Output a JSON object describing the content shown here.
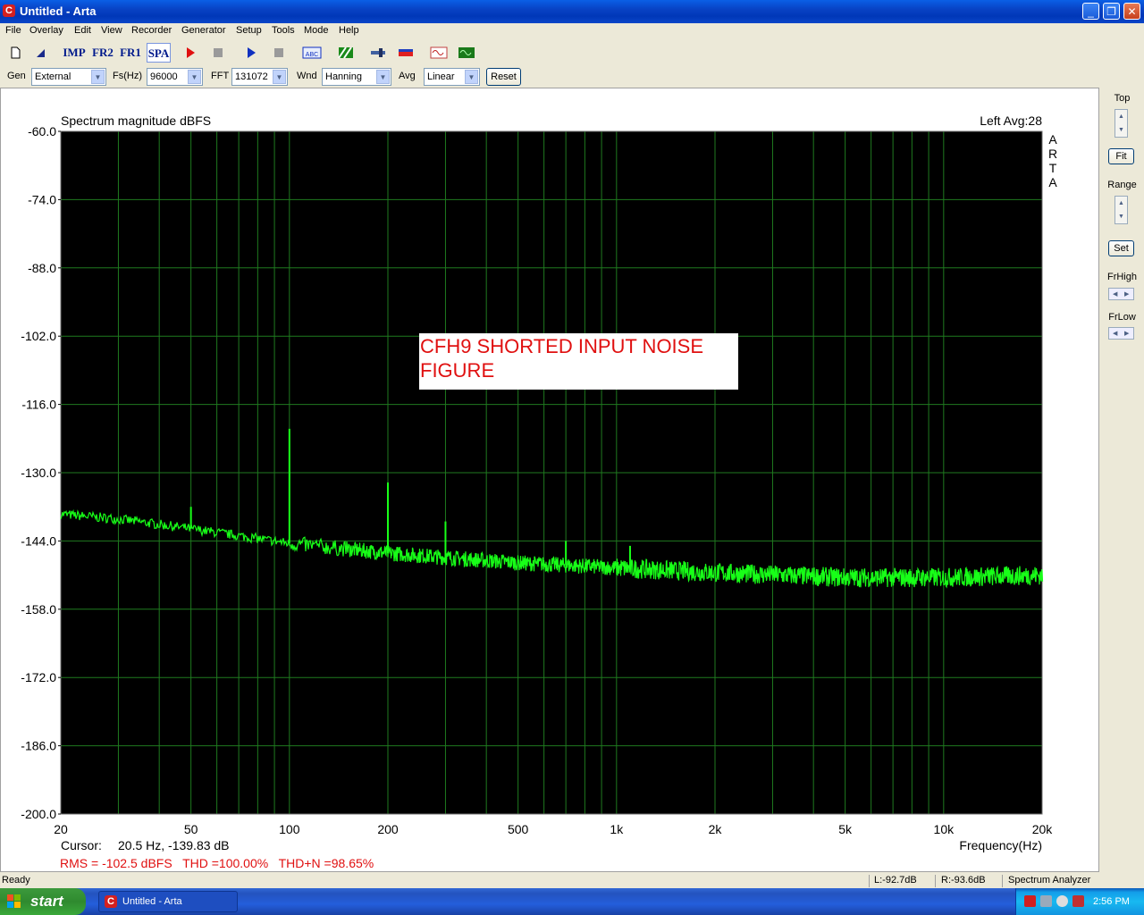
{
  "window": {
    "title": "Untitled - Arta",
    "app_icon": "C"
  },
  "menu": [
    "File",
    "Overlay",
    "Edit",
    "View",
    "Recorder",
    "Generator",
    "Setup",
    "Tools",
    "Mode",
    "Help"
  ],
  "toolbar": {
    "imp": "IMP",
    "fr2": "FR2",
    "fr1": "FR1",
    "spa": "SPA",
    "abc": "ABC"
  },
  "params": {
    "gen_label": "Gen",
    "gen_value": "External",
    "fs_label": "Fs(Hz)",
    "fs_value": "96000",
    "fft_label": "FFT",
    "fft_value": "131072",
    "wnd_label": "Wnd",
    "wnd_value": "Hanning",
    "avg_label": "Avg",
    "avg_value": "Linear",
    "reset_label": "Reset"
  },
  "side": {
    "top_label": "Top",
    "fit_label": "Fit",
    "range_label": "Range",
    "set_label": "Set",
    "frhigh_label": "FrHigh",
    "frlow_label": "FrLow"
  },
  "plot": {
    "title": "Spectrum magnitude dBFS",
    "channel_info": "Left  Avg:28",
    "watermark": [
      "A",
      "R",
      "T",
      "A"
    ],
    "annotation_line1": "CFH9 SHORTED INPUT NOISE",
    "annotation_line2": "FIGURE",
    "xlabel": "Frequency(Hz)",
    "cursor_label": "Cursor:",
    "cursor_value": "20.5 Hz, -139.83 dB",
    "stats": "RMS = -102.5 dBFS   THD =100.00%   THD+N =98.65%"
  },
  "chart_data": {
    "type": "line",
    "x_scale": "log",
    "xlim": [
      20,
      20000
    ],
    "ylim": [
      -200,
      -60
    ],
    "y_ticks": [
      "-60.0",
      "-74.0",
      "-88.0",
      "-102.0",
      "-116.0",
      "-130.0",
      "-144.0",
      "-158.0",
      "-172.0",
      "-186.0",
      "-200.0"
    ],
    "x_ticks": [
      {
        "value": 20,
        "label": "20"
      },
      {
        "value": 50,
        "label": "50"
      },
      {
        "value": 100,
        "label": "100"
      },
      {
        "value": 200,
        "label": "200"
      },
      {
        "value": 500,
        "label": "500"
      },
      {
        "value": 1000,
        "label": "1k"
      },
      {
        "value": 2000,
        "label": "2k"
      },
      {
        "value": 5000,
        "label": "5k"
      },
      {
        "value": 10000,
        "label": "10k"
      },
      {
        "value": 20000,
        "label": "20k"
      }
    ],
    "grid": true,
    "background": "#000000",
    "grid_color": "#1f7a1f",
    "trace_color": "#18ff18",
    "series": [
      {
        "noise_floor": [
          [
            20,
            -138.5
          ],
          [
            30,
            -139.5
          ],
          [
            50,
            -141.5
          ],
          [
            80,
            -143.5
          ],
          [
            100,
            -144.5
          ],
          [
            200,
            -146.5
          ],
          [
            500,
            -148.5
          ],
          [
            1000,
            -149.5
          ],
          [
            2000,
            -150.5
          ],
          [
            5000,
            -151.5
          ],
          [
            10000,
            -151.5
          ],
          [
            20000,
            -151.0
          ]
        ],
        "peaks": [
          [
            50,
            -137.0
          ],
          [
            100,
            -121.0
          ],
          [
            200,
            -132.0
          ],
          [
            300,
            -140.0
          ],
          [
            700,
            -144.0
          ],
          [
            1100,
            -145.0
          ]
        ]
      }
    ]
  },
  "status": {
    "left": "Ready",
    "l_level": "L:-92.7dB",
    "r_level": "R:-93.6dB",
    "mode": "Spectrum Analyzer"
  },
  "taskbar": {
    "start_label": "start",
    "task_label": "Untitled - Arta",
    "clock": "2:56 PM"
  }
}
